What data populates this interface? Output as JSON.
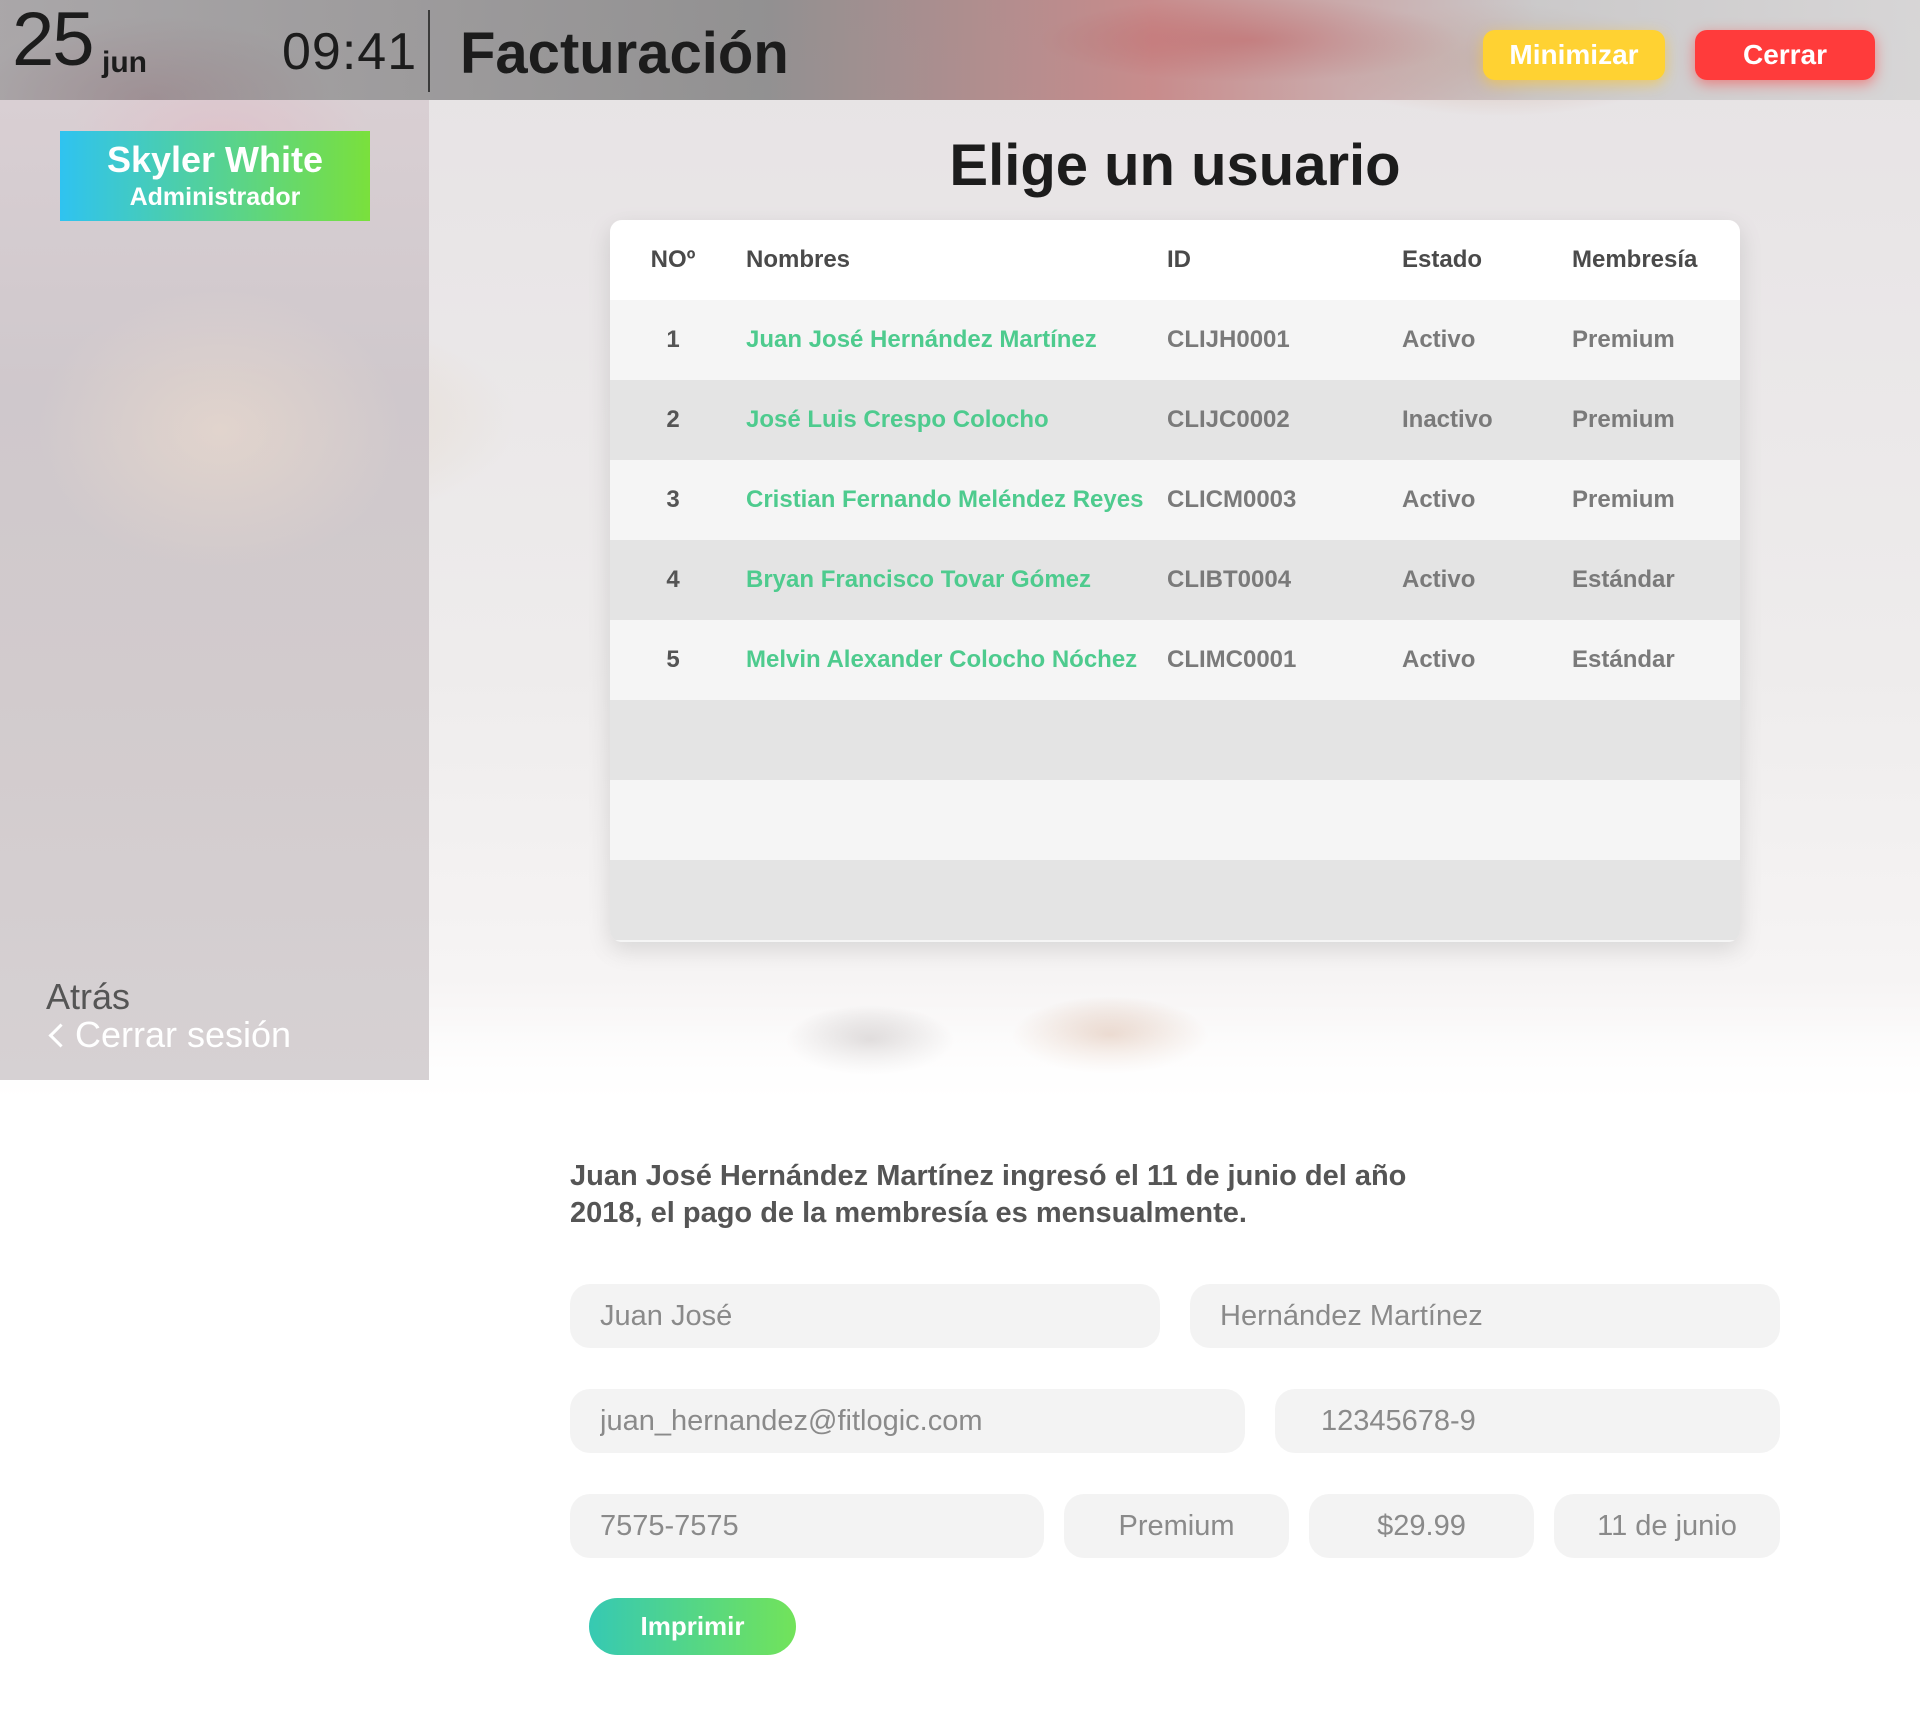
{
  "header": {
    "day": "25",
    "month": "jun",
    "time": "09:41",
    "title": "Facturación",
    "minimize_label": "Minimizar",
    "close_label": "Cerrar",
    "minimize_color": "#ffd232",
    "close_color": "#ff3b3b"
  },
  "sidebar": {
    "user_name": "Skyler White",
    "user_role": "Administrador",
    "back_label": "Atrás",
    "logout_label": "Cerrar sesión"
  },
  "main": {
    "title": "Elige un usuario"
  },
  "table": {
    "headers": [
      "NOº",
      "Nombres",
      "ID",
      "Estado",
      "Membresía"
    ],
    "rows": [
      [
        "1",
        "Juan José Hernández Martínez",
        "CLIJH0001",
        "Activo",
        "Premium"
      ],
      [
        "2",
        "José Luis Crespo Colocho",
        "CLIJC0002",
        "Inactivo",
        "Premium"
      ],
      [
        "3",
        "Cristian Fernando Meléndez Reyes",
        "CLICM0003",
        "Activo",
        "Premium"
      ],
      [
        "4",
        "Bryan Francisco Tovar Gómez",
        "CLIBT0004",
        "Activo",
        "Estándar"
      ],
      [
        "5",
        "Melvin Alexander Colocho Nóchez",
        "CLIMC0001",
        "Activo",
        "Estándar"
      ]
    ],
    "name_color": "#4ecb8e"
  },
  "detail": {
    "line1": "Juan José Hernández Martínez ingresó el 11 de junio del año",
    "line2": "2018, el pago de la membresía es mensualmente.",
    "fields": {
      "first_name": "Juan José",
      "last_name": "Hernández Martínez",
      "email": "juan_hernandez@fitlogic.com",
      "document": "12345678-9",
      "phone": "7575-7575",
      "membership": "Premium",
      "price": "$29.99",
      "date": "11 de junio"
    },
    "print_label": "Imprimir"
  }
}
